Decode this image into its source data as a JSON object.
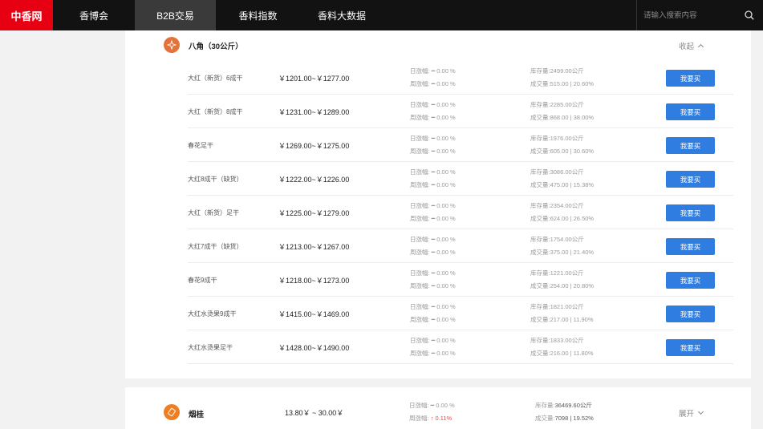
{
  "brand": "中香网",
  "nav": [
    {
      "label": "香博会",
      "active": false
    },
    {
      "label": "B2B交易",
      "active": true
    },
    {
      "label": "香料指数",
      "active": false
    },
    {
      "label": "香料大数据",
      "active": false
    }
  ],
  "search": {
    "placeholder": "请输入搜索内容"
  },
  "category": {
    "title": "八角（30公斤）",
    "toggle_label": "收起",
    "rows": [
      {
        "name": "大红（新货）6成干",
        "price": "￥1201.00~￥1277.00",
        "day": "日涨幅: ━ 0.00 %",
        "week": "周涨幅: ━ 0.00 %",
        "stock": "库存量:2499.00公斤",
        "volume": "成交量:515.00 | 20.60%",
        "buy": "我要买"
      },
      {
        "name": "大红（新货）8成干",
        "price": "￥1231.00~￥1289.00",
        "day": "日涨幅: ━ 0.00 %",
        "week": "周涨幅: ━ 0.00 %",
        "stock": "库存量:2285.00公斤",
        "volume": "成交量:868.00 | 38.00%",
        "buy": "我要买"
      },
      {
        "name": "春花足干",
        "price": "￥1269.00~￥1275.00",
        "day": "日涨幅: ━ 0.00 %",
        "week": "周涨幅: ━ 0.00 %",
        "stock": "库存量:1976.00公斤",
        "volume": "成交量:605.00 | 30.60%",
        "buy": "我要买"
      },
      {
        "name": "大红8成干（缺货）",
        "price": "￥1222.00~￥1226.00",
        "day": "日涨幅: ━ 0.00 %",
        "week": "周涨幅: ━ 0.00 %",
        "stock": "库存量:3086.00公斤",
        "volume": "成交量:475.00 | 15.38%",
        "buy": "我要买"
      },
      {
        "name": "大红（新货）足干",
        "price": "￥1225.00~￥1279.00",
        "day": "日涨幅: ━ 0.00 %",
        "week": "周涨幅: ━ 0.00 %",
        "stock": "库存量:2354.00公斤",
        "volume": "成交量:624.00 | 26.50%",
        "buy": "我要买"
      },
      {
        "name": "大红7成干（缺货）",
        "price": "￥1213.00~￥1267.00",
        "day": "日涨幅: ━ 0.00 %",
        "week": "周涨幅: ━ 0.00 %",
        "stock": "库存量:1754.00公斤",
        "volume": "成交量:375.00 | 21.40%",
        "buy": "我要买"
      },
      {
        "name": "春花9成干",
        "price": "￥1218.00~￥1273.00",
        "day": "日涨幅: ━ 0.00 %",
        "week": "周涨幅: ━ 0.00 %",
        "stock": "库存量:1221.00公斤",
        "volume": "成交量:254.00 | 20.80%",
        "buy": "我要买"
      },
      {
        "name": "大红水烫果9成干",
        "price": "￥1415.00~￥1469.00",
        "day": "日涨幅: ━ 0.00 %",
        "week": "周涨幅: ━ 0.00 %",
        "stock": "库存量:1821.00公斤",
        "volume": "成交量:217.00 | 11.90%",
        "buy": "我要买"
      },
      {
        "name": "大红水烫果足干",
        "price": "￥1428.00~￥1490.00",
        "day": "日涨幅: ━ 0.00 %",
        "week": "周涨幅: ━ 0.00 %",
        "stock": "库存量:1833.00公斤",
        "volume": "成交量:216.00 | 11.80%",
        "buy": "我要买"
      }
    ]
  },
  "category2": {
    "title": "烟桂",
    "price": "13.80￥ ~ 30.00￥",
    "day": "日涨幅: ━ 0.00 %",
    "week_label": "周涨幅:",
    "week_value": "↑ 0.11%",
    "stock_label": "库存量:",
    "stock_value": "36469.60公斤",
    "volume_label": "成交量:",
    "volume_value": "7098 | 19.52%",
    "toggle_label": "展开"
  },
  "colors": {
    "brand": "#e60012",
    "topbar": "#121212",
    "button": "#2f7de1",
    "up": "#e54848",
    "icon1": "#e2733a",
    "icon2": "#ef7d22"
  },
  "icons": {
    "search": "search-icon",
    "category1": "star-anise-icon",
    "category2": "cinnamon-icon"
  }
}
